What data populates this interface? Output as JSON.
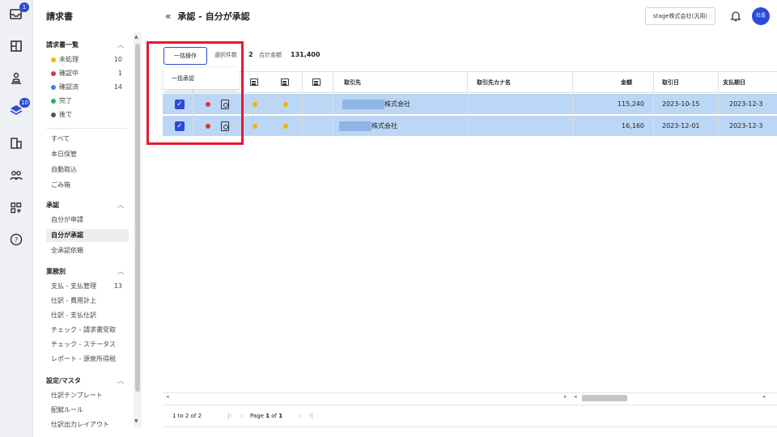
{
  "rail": {
    "inbox_badge": "1",
    "approval_badge": "10"
  },
  "sidebar": {
    "app_title": "請求書",
    "invoice_list": {
      "title": "請求書一覧",
      "items": [
        {
          "label": "未処理",
          "count": "10",
          "color": "#f2b600"
        },
        {
          "label": "確認中",
          "count": "1",
          "color": "#e5303a"
        },
        {
          "label": "確認済",
          "count": "14",
          "color": "#3c82e8"
        },
        {
          "label": "完了",
          "count": "",
          "color": "#26b24a"
        },
        {
          "label": "後で",
          "count": "",
          "color": "#555555"
        }
      ]
    },
    "misc_items": [
      "すべて",
      "本日保管",
      "自動取込",
      "ごみ箱"
    ],
    "approval": {
      "title": "承認",
      "items": [
        "自分が申請",
        "自分が承認",
        "全承認依頼"
      ]
    },
    "business": {
      "title": "業務別",
      "items": [
        {
          "label": "支払 - 支払管理",
          "count": "13"
        },
        {
          "label": "仕訳 - 費用計上",
          "count": ""
        },
        {
          "label": "仕訳 - 支払仕訳",
          "count": ""
        },
        {
          "label": "チェック - 請求書受取",
          "count": ""
        },
        {
          "label": "チェック - ステータス",
          "count": ""
        },
        {
          "label": "レポート - 源泉所得税",
          "count": ""
        }
      ]
    },
    "settings": {
      "title": "設定/マスタ",
      "items": [
        "仕訳テンプレート",
        "配賦ルール",
        "仕訳出力レイアウト"
      ]
    }
  },
  "header": {
    "collapse_icon": "«",
    "title": "承認 - 自分が承認",
    "company": "stage株式会社(汎用)",
    "avatar": "社長"
  },
  "toolbar": {
    "bulk_button": "一括操作",
    "selected_label": "選択件数",
    "selected_count": "2",
    "total_label": "合計金額",
    "total_amount": "131,400",
    "menu_item": "一括承認"
  },
  "table": {
    "columns": {
      "partner": "取引先",
      "partner_kana": "取引先カナ名",
      "amount": "金額",
      "trade_date": "取引日",
      "due_date": "支払期日"
    },
    "rows": [
      {
        "partner": "株式会社",
        "amount": "115,240",
        "trade_date": "2023-10-15",
        "due_date": "2023-12-3"
      },
      {
        "partner": "株式会社",
        "amount": "16,160",
        "trade_date": "2023-12-01",
        "due_date": "2023-12-3"
      }
    ]
  },
  "pager": {
    "range": "1 to 2 of 2",
    "page_label": "Page",
    "page_current": "1",
    "of_label": "of",
    "page_total": "1"
  }
}
